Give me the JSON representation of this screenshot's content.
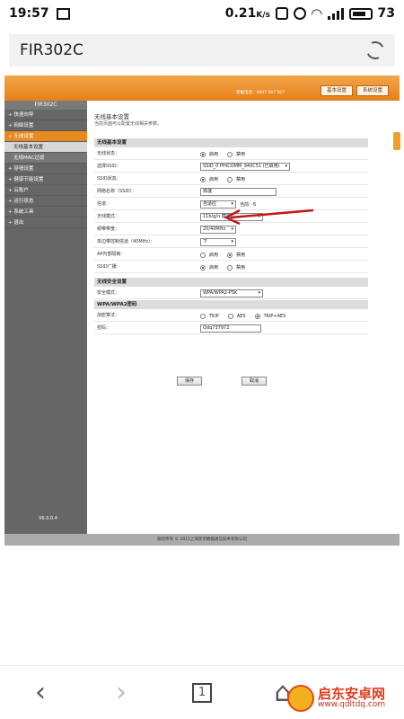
{
  "status_bar": {
    "time": "19:57",
    "network_speed": "0.21",
    "speed_unit": "K/s",
    "battery": "73"
  },
  "browser": {
    "title": "FIR302C"
  },
  "router": {
    "hotline": "客服电话：4007 567 567",
    "top_buttons": [
      "基本设置",
      "系统设置"
    ],
    "sidebar_title": "FIR302C",
    "sidebar_items": [
      {
        "label": "+ 快速向导",
        "state": "normal"
      },
      {
        "label": "+ 网络设置",
        "state": "normal"
      },
      {
        "label": "+ 无线设置",
        "state": "active"
      },
      {
        "label": "无线基本设置",
        "state": "subactive"
      },
      {
        "label": "无线MAC过滤",
        "state": "sub"
      },
      {
        "label": "+ 穿墙设置",
        "state": "normal"
      },
      {
        "label": "+ 健康节能设置",
        "state": "normal"
      },
      {
        "label": "+ 云账户",
        "state": "normal"
      },
      {
        "label": "+ 运行状态",
        "state": "normal"
      },
      {
        "label": "+ 系统工具",
        "state": "normal"
      },
      {
        "label": "+ 退出",
        "state": "normal"
      }
    ],
    "version": "V6.0.0.4",
    "content_title": "无线基本设置",
    "content_desc": "当前页面可以配置无线相关参数。",
    "basic_section": "无线基本设置",
    "basic_rows": [
      {
        "label": "无线状态：",
        "radios": [
          {
            "label": "启用",
            "on": true
          },
          {
            "label": "禁用",
            "on": false
          }
        ]
      },
      {
        "label": "选择SSID：",
        "select": "SSID_0 PHICOMM_940C51 (已启用)",
        "w": 100
      },
      {
        "label": "SSID状态：",
        "radios": [
          {
            "label": "启用",
            "on": true
          },
          {
            "label": "禁用",
            "on": false
          }
        ]
      },
      {
        "label": "网络名称（SSID）：",
        "input": "铁莲",
        "w": 85
      },
      {
        "label": "信道：",
        "select": "自适应",
        "w": 40,
        "extra": "当前：6"
      },
      {
        "label": "无线模式：",
        "select": "11b/g/n 模式",
        "w": 70
      },
      {
        "label": "频带带宽：",
        "select": "20/40MHz",
        "w": 40
      },
      {
        "label": "单边带控制信道（40MHz）：",
        "select": "下",
        "w": 40
      },
      {
        "label": "AP内部隔离：",
        "radios": [
          {
            "label": "启用",
            "on": false
          },
          {
            "label": "禁用",
            "on": true
          }
        ]
      },
      {
        "label": "SSID广播：",
        "radios": [
          {
            "label": "启用",
            "on": true
          },
          {
            "label": "禁用",
            "on": false
          }
        ]
      }
    ],
    "security_section": "无线安全设置",
    "security_mode_label": "安全模式：",
    "security_mode": "WPA/WPA2-PSK",
    "wpa_section": "WPA/WPA2密码",
    "encrypt_label": "加密算法：",
    "encrypt_options": [
      {
        "label": "TKIP",
        "on": false
      },
      {
        "label": "AES",
        "on": false
      },
      {
        "label": "TKIP+AES",
        "on": true
      }
    ],
    "password_label": "密码：",
    "password": "Qdq737972",
    "save_label": "保存",
    "cancel_label": "取消",
    "footer": "版权所有 © 2015上海斐讯数据通信技术有限公司"
  },
  "bottom_nav": {
    "tab_count": "1"
  },
  "watermark": {
    "cn": "启东安卓网",
    "url": "www.qdltdq.com"
  },
  "colors": {
    "banner": "#e88a1e",
    "sidebar": "#666666",
    "arrow": "#c01818"
  }
}
